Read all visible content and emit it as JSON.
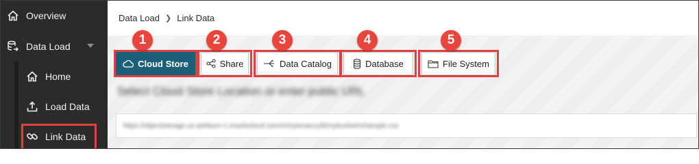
{
  "sidebar": {
    "overview": {
      "label": "Overview",
      "icon": "home-icon"
    },
    "data_load": {
      "label": "Data Load",
      "icon": "data-load-icon"
    },
    "sub_items": [
      {
        "label": "Home",
        "icon": "home-icon"
      },
      {
        "label": "Load Data",
        "icon": "upload-icon"
      },
      {
        "label": "Link Data",
        "icon": "link-icon"
      }
    ]
  },
  "breadcrumb": {
    "parent": "Data Load",
    "current": "Link Data"
  },
  "tabs": [
    {
      "label": "Cloud Store",
      "icon": "cloud-icon",
      "badge": "1",
      "active": true
    },
    {
      "label": "Share",
      "icon": "share-icon",
      "badge": "2",
      "active": false
    },
    {
      "label": "Data Catalog",
      "icon": "catalog-icon",
      "badge": "3",
      "active": false
    },
    {
      "label": "Database",
      "icon": "database-icon",
      "badge": "4",
      "active": false
    },
    {
      "label": "File System",
      "icon": "folder-icon",
      "badge": "5",
      "active": false
    }
  ],
  "cloud_store": {
    "location_label": "Select Cloud Store Location or enter public URL",
    "url_value": "https://objectstorage.us-ashburn-1.oraclecloud.com/n/mytenancy/b/mybucket/o/sample.csv"
  },
  "colors": {
    "sidebar_bg": "#2b2b2b",
    "active_tab": "#1c5f79",
    "highlight_red": "#e04040",
    "badge_red": "#e8453c"
  }
}
